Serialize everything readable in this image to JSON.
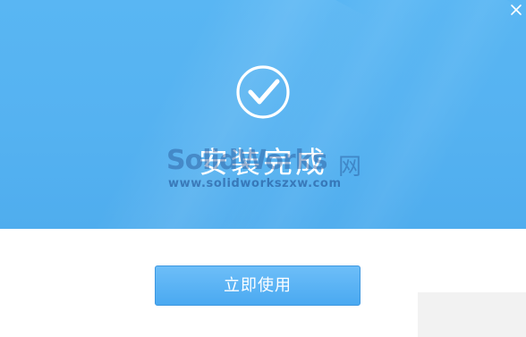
{
  "dialog": {
    "status_title": "安装完成",
    "action_button_label": "立即使用",
    "close_icon": "close-icon",
    "check_icon": "check-circle-icon"
  },
  "watermark": {
    "logo_text": "SolidWorks",
    "net_text": "网",
    "url_text": "www.solidworkszxw.com"
  },
  "colors": {
    "header_blue": "#55b2f1",
    "button_blue": "#5bb3f4",
    "white": "#ffffff"
  }
}
